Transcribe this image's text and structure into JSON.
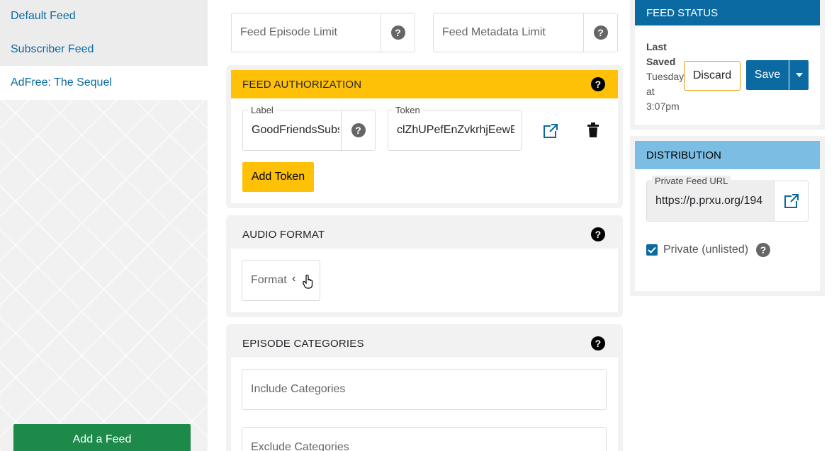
{
  "sidebar": {
    "items": [
      {
        "label": "Default Feed"
      },
      {
        "label": "Subscriber Feed"
      },
      {
        "label": "AdFree: The Sequel"
      }
    ],
    "add_feed_label": "Add a Feed"
  },
  "limits": {
    "episode_limit_placeholder": "Feed Episode Limit",
    "metadata_limit_placeholder": "Feed Metadata Limit"
  },
  "feed_authorization": {
    "title": "FEED AUTHORIZATION",
    "label_caption": "Label",
    "label_value": "GoodFriendsSubs",
    "token_caption": "Token",
    "token_value": "clZhUPefEnZvkrhjEewE",
    "add_token_label": "Add Token",
    "header_color": "#ffc107"
  },
  "audio_format": {
    "title": "AUDIO FORMAT",
    "format_placeholder": "Format"
  },
  "episode_categories": {
    "title": "EPISODE CATEGORIES",
    "include_placeholder": "Include Categories",
    "exclude_placeholder": "Exclude Categories"
  },
  "feed_status": {
    "title": "FEED STATUS",
    "last_saved_label_1": "Last",
    "last_saved_label_2": "Saved",
    "last_saved_value_1": "Tuesday",
    "last_saved_value_2": "at",
    "last_saved_value_3": "3:07pm",
    "discard_label": "Discard",
    "save_label": "Save",
    "header_color": "#0a6aa1"
  },
  "distribution": {
    "title": "DISTRIBUTION",
    "url_caption": "Private Feed URL",
    "url_value": "https://p.prxu.org/194",
    "private_label": "Private (unlisted)",
    "private_checked": true,
    "header_color": "#7bbde3"
  }
}
